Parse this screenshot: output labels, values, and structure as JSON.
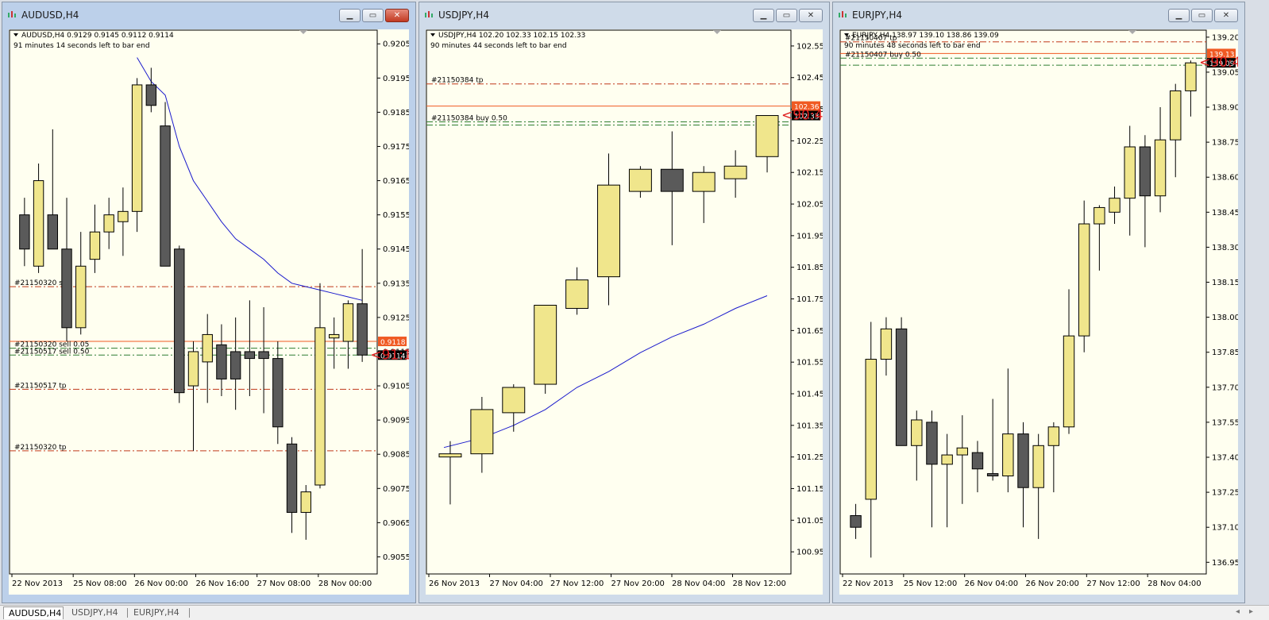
{
  "windows": [
    {
      "title": "AUDUSD,H4",
      "header": "AUDUSD,H4  0.9129 0.9145 0.9112 0.9114",
      "timer": "91 minutes 14 seconds left to bar end",
      "y_range": [
        0.905,
        0.9209
      ],
      "y_ticks": [
        "0.9205",
        "0.9195",
        "0.9185",
        "0.9175",
        "0.9165",
        "0.9155",
        "0.9145",
        "0.9135",
        "0.9125",
        "0.9115",
        "0.9105",
        "0.9095",
        "0.9085",
        "0.9075",
        "0.9065",
        "0.9055"
      ],
      "x_labels": [
        "22 Nov 2013",
        "25 Nov 08:00",
        "26 Nov 00:00",
        "26 Nov 16:00",
        "27 Nov 08:00",
        "28 Nov 00:00"
      ],
      "candles": [
        [
          0.9155,
          0.916,
          0.914,
          0.9145
        ],
        [
          0.914,
          0.917,
          0.9138,
          0.9165
        ],
        [
          0.9155,
          0.918,
          0.9145,
          0.9145
        ],
        [
          0.9145,
          0.916,
          0.9118,
          0.9122
        ],
        [
          0.9122,
          0.915,
          0.912,
          0.914
        ],
        [
          0.9142,
          0.9158,
          0.9138,
          0.915
        ],
        [
          0.915,
          0.916,
          0.9145,
          0.9155
        ],
        [
          0.9153,
          0.9163,
          0.9143,
          0.9156
        ],
        [
          0.9156,
          0.9195,
          0.915,
          0.9193
        ],
        [
          0.9193,
          0.9198,
          0.9185,
          0.9187
        ],
        [
          0.9181,
          0.9188,
          0.914,
          0.914
        ],
        [
          0.9145,
          0.9146,
          0.91,
          0.9103
        ],
        [
          0.9105,
          0.9118,
          0.9086,
          0.9115
        ],
        [
          0.9112,
          0.9126,
          0.91,
          0.912
        ],
        [
          0.9117,
          0.9123,
          0.9102,
          0.9107
        ],
        [
          0.9115,
          0.9125,
          0.9098,
          0.9107
        ],
        [
          0.9115,
          0.913,
          0.9102,
          0.9113
        ],
        [
          0.9115,
          0.9128,
          0.9097,
          0.9113
        ],
        [
          0.9113,
          0.9118,
          0.9088,
          0.9093
        ],
        [
          0.9088,
          0.909,
          0.9062,
          0.9068
        ],
        [
          0.9068,
          0.9076,
          0.906,
          0.9074
        ],
        [
          0.9076,
          0.9135,
          0.9075,
          0.9122
        ],
        [
          0.9119,
          0.9125,
          0.911,
          0.912
        ],
        [
          0.9118,
          0.913,
          0.911,
          0.9129
        ],
        [
          0.9129,
          0.9145,
          0.9112,
          0.9114
        ]
      ],
      "ma": [
        [
          8,
          0.9201
        ],
        [
          9,
          0.9194
        ],
        [
          10,
          0.919
        ],
        [
          11,
          0.9175
        ],
        [
          12,
          0.9165
        ],
        [
          13,
          0.9159
        ],
        [
          14,
          0.9153
        ],
        [
          15,
          0.9148
        ],
        [
          16,
          0.9145
        ],
        [
          17,
          0.9142
        ],
        [
          18,
          0.9138
        ],
        [
          19,
          0.9135
        ],
        [
          20,
          0.9134
        ],
        [
          21,
          0.9133
        ],
        [
          22,
          0.9132
        ],
        [
          23,
          0.9131
        ],
        [
          24,
          0.913
        ]
      ],
      "lines": [
        {
          "y": 0.9134,
          "style": "sl",
          "label": "#21150320 sl"
        },
        {
          "y": 0.9118,
          "style": "order",
          "label": ""
        },
        {
          "y": 0.9116,
          "style": "entry",
          "label": "#21150320 sell 0.05"
        },
        {
          "y": 0.9114,
          "style": "entry",
          "label": "#21150517 sell 0.50"
        },
        {
          "y": 0.9104,
          "style": "tp",
          "label": "#21150517 tp"
        },
        {
          "y": 0.9086,
          "style": "tp",
          "label": "#21150320 tp"
        }
      ],
      "price_tags": [
        {
          "y": 0.9118,
          "text": "0.9118",
          "color": "#f05a23"
        },
        {
          "y": 0.9114,
          "text": "0.9114",
          "color": "#000000"
        }
      ],
      "countdown": "<91:14"
    },
    {
      "title": "USDJPY,H4",
      "header": "USDJPY,H4  102.20 102.33 102.15 102.33",
      "timer": "90 minutes 44 seconds left to bar end",
      "y_range": [
        100.88,
        102.6
      ],
      "y_ticks": [
        "102.55",
        "102.45",
        "102.35",
        "102.25",
        "102.15",
        "102.05",
        "101.95",
        "101.85",
        "101.75",
        "101.65",
        "101.55",
        "101.45",
        "101.35",
        "101.25",
        "101.15",
        "101.05",
        "100.95"
      ],
      "x_labels": [
        "26 Nov 2013",
        "27 Nov 04:00",
        "27 Nov 12:00",
        "27 Nov 20:00",
        "28 Nov 04:00",
        "28 Nov 12:00"
      ],
      "candles": [
        [
          101.25,
          101.3,
          101.1,
          101.26
        ],
        [
          101.26,
          101.44,
          101.2,
          101.4
        ],
        [
          101.39,
          101.48,
          101.33,
          101.47
        ],
        [
          101.48,
          101.73,
          101.45,
          101.73
        ],
        [
          101.72,
          101.85,
          101.7,
          101.81
        ],
        [
          101.82,
          102.21,
          101.73,
          102.11
        ],
        [
          102.09,
          102.17,
          102.07,
          102.16
        ],
        [
          102.16,
          102.28,
          101.92,
          102.09
        ],
        [
          102.09,
          102.17,
          101.99,
          102.15
        ],
        [
          102.13,
          102.22,
          102.07,
          102.17
        ],
        [
          102.2,
          102.33,
          102.15,
          102.33
        ]
      ],
      "ma": [
        [
          -0.2,
          101.28
        ],
        [
          1,
          101.31
        ],
        [
          2,
          101.35
        ],
        [
          3,
          101.4
        ],
        [
          4,
          101.47
        ],
        [
          5,
          101.52
        ],
        [
          6,
          101.58
        ],
        [
          7,
          101.63
        ],
        [
          8,
          101.67
        ],
        [
          9,
          101.72
        ],
        [
          10,
          101.76
        ]
      ],
      "lines": [
        {
          "y": 102.43,
          "style": "tp",
          "label": "#21150384 tp"
        },
        {
          "y": 102.36,
          "style": "order",
          "label": ""
        },
        {
          "y": 102.31,
          "style": "entry",
          "label": "#21150384 buy 0.50"
        },
        {
          "y": 102.3,
          "style": "entry",
          "label": ""
        }
      ],
      "price_tags": [
        {
          "y": 102.36,
          "text": "102.36",
          "color": "#f05a23"
        },
        {
          "y": 102.33,
          "text": "102.33",
          "color": "#000000"
        }
      ],
      "countdown": "<90:44"
    },
    {
      "title": "EURJPY,H4",
      "header": "EURJPY,H4  138.97 139.10 138.86 139.09",
      "timer": "90 minutes 48 seconds left to bar end",
      "y_range": [
        136.9,
        139.23
      ],
      "y_ticks": [
        "139.20",
        "139.05",
        "138.90",
        "138.75",
        "138.60",
        "138.45",
        "138.30",
        "138.15",
        "138.00",
        "137.85",
        "137.70",
        "137.55",
        "137.40",
        "137.25",
        "137.10",
        "136.95"
      ],
      "x_labels": [
        "22 Nov 2013",
        "25 Nov 12:00",
        "26 Nov 04:00",
        "26 Nov 20:00",
        "27 Nov 12:00",
        "28 Nov 04:00"
      ],
      "candles": [
        [
          137.15,
          137.2,
          137.05,
          137.1
        ],
        [
          137.22,
          137.98,
          136.97,
          137.82
        ],
        [
          137.82,
          138.0,
          137.75,
          137.95
        ],
        [
          137.95,
          138.0,
          137.45,
          137.45
        ],
        [
          137.45,
          137.6,
          137.3,
          137.56
        ],
        [
          137.55,
          137.6,
          137.1,
          137.37
        ],
        [
          137.37,
          137.5,
          137.1,
          137.41
        ],
        [
          137.41,
          137.58,
          137.2,
          137.44
        ],
        [
          137.42,
          137.47,
          137.25,
          137.35
        ],
        [
          137.33,
          137.65,
          137.3,
          137.32
        ],
        [
          137.32,
          137.78,
          137.25,
          137.5
        ],
        [
          137.5,
          137.55,
          137.1,
          137.27
        ],
        [
          137.27,
          137.5,
          137.05,
          137.45
        ],
        [
          137.45,
          137.55,
          137.25,
          137.53
        ],
        [
          137.53,
          138.12,
          137.5,
          137.92
        ],
        [
          137.92,
          138.5,
          137.85,
          138.4
        ],
        [
          138.4,
          138.48,
          138.2,
          138.47
        ],
        [
          138.45,
          138.56,
          138.4,
          138.51
        ],
        [
          138.51,
          138.82,
          138.35,
          138.73
        ],
        [
          138.73,
          138.78,
          138.3,
          138.52
        ],
        [
          138.52,
          138.9,
          138.45,
          138.76
        ],
        [
          138.76,
          139.0,
          138.6,
          138.97
        ],
        [
          138.97,
          139.1,
          138.86,
          139.09
        ]
      ],
      "ma": [],
      "lines": [
        {
          "y": 139.18,
          "style": "tp",
          "label": "#21150407 tp"
        },
        {
          "y": 139.13,
          "style": "order",
          "label": ""
        },
        {
          "y": 139.11,
          "style": "entry",
          "label": "#21150407 buy 0.50"
        },
        {
          "y": 139.08,
          "style": "entry",
          "label": ""
        }
      ],
      "price_tags": [
        {
          "y": 139.13,
          "text": "139.13",
          "color": "#f05a23"
        },
        {
          "y": 139.09,
          "text": "139.09",
          "color": "#000000"
        }
      ],
      "countdown": "<90:48"
    }
  ],
  "taskbar": {
    "tabs": [
      "AUDUSD,H4",
      "USDJPY,H4",
      "EURJPY,H4"
    ]
  },
  "colors": {
    "chart_bg": "#fffff0",
    "bull": "#f0e68c",
    "bear": "#5a5a5a",
    "ma": "#1a1acc",
    "tp_line": "#c0391b",
    "entry_line": "#2e7d32",
    "order_line": "#f05a23",
    "countdown": "#e02020"
  }
}
